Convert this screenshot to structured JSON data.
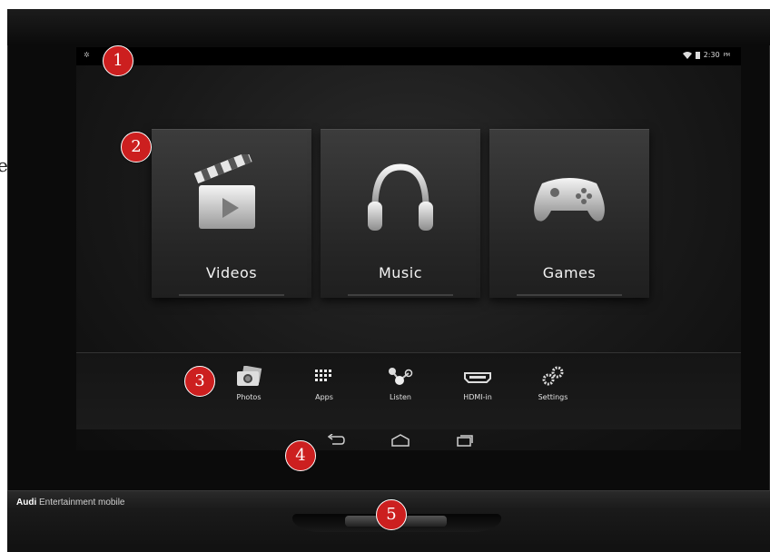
{
  "edge_char": "e",
  "status": {
    "time": "2:30",
    "ampm": "PM"
  },
  "tiles": [
    {
      "label": "Videos",
      "icon": "clapperboard-icon"
    },
    {
      "label": "Music",
      "icon": "headphones-icon"
    },
    {
      "label": "Games",
      "icon": "gamepad-icon"
    }
  ],
  "dock": [
    {
      "label": "Photos",
      "icon": "photos-icon"
    },
    {
      "label": "Apps",
      "icon": "apps-grid-icon"
    },
    {
      "label": "Listen",
      "icon": "share-nodes-icon"
    },
    {
      "label": "HDMI-in",
      "icon": "hdmi-port-icon"
    },
    {
      "label": "Settings",
      "icon": "gears-icon"
    }
  ],
  "nav": [
    {
      "icon": "back-icon"
    },
    {
      "icon": "home-icon"
    },
    {
      "icon": "recent-apps-icon"
    }
  ],
  "brand": {
    "prefix": "Audi",
    "suffix": "Entertainment mobile"
  },
  "markers": [
    "1",
    "2",
    "3",
    "4",
    "5"
  ],
  "colors": {
    "marker": "#cc1f1f",
    "tile_bg": "#2e2e2e",
    "device": "#0b0b0b"
  }
}
